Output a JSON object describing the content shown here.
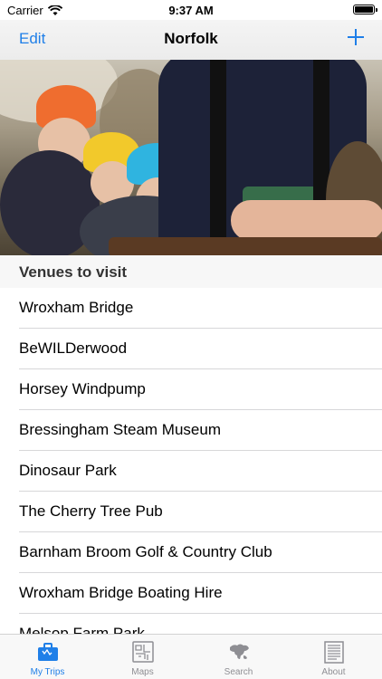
{
  "status_bar": {
    "carrier": "Carrier",
    "time": "9:37 AM"
  },
  "nav": {
    "edit_label": "Edit",
    "title": "Norfolk",
    "add_icon": "plus-icon"
  },
  "section_header": "Venues to visit",
  "venues": [
    "Wroxham Bridge",
    "BeWILDerwood",
    "Horsey Windpump",
    "Bressingham Steam Museum",
    "Dinosaur Park",
    "The Cherry Tree Pub",
    "Barnham Broom Golf & Country Club",
    "Wroxham Bridge Boating Hire",
    "Melsop Farm Park"
  ],
  "tabs": [
    {
      "label": "My Trips",
      "icon": "suitcase-icon",
      "active": true
    },
    {
      "label": "Maps",
      "icon": "map-icon",
      "active": false
    },
    {
      "label": "Search",
      "icon": "globe-icon",
      "active": false
    },
    {
      "label": "About",
      "icon": "document-icon",
      "active": false
    }
  ],
  "colors": {
    "accent": "#1f7fe8",
    "tab_inactive": "#8e8e93"
  }
}
